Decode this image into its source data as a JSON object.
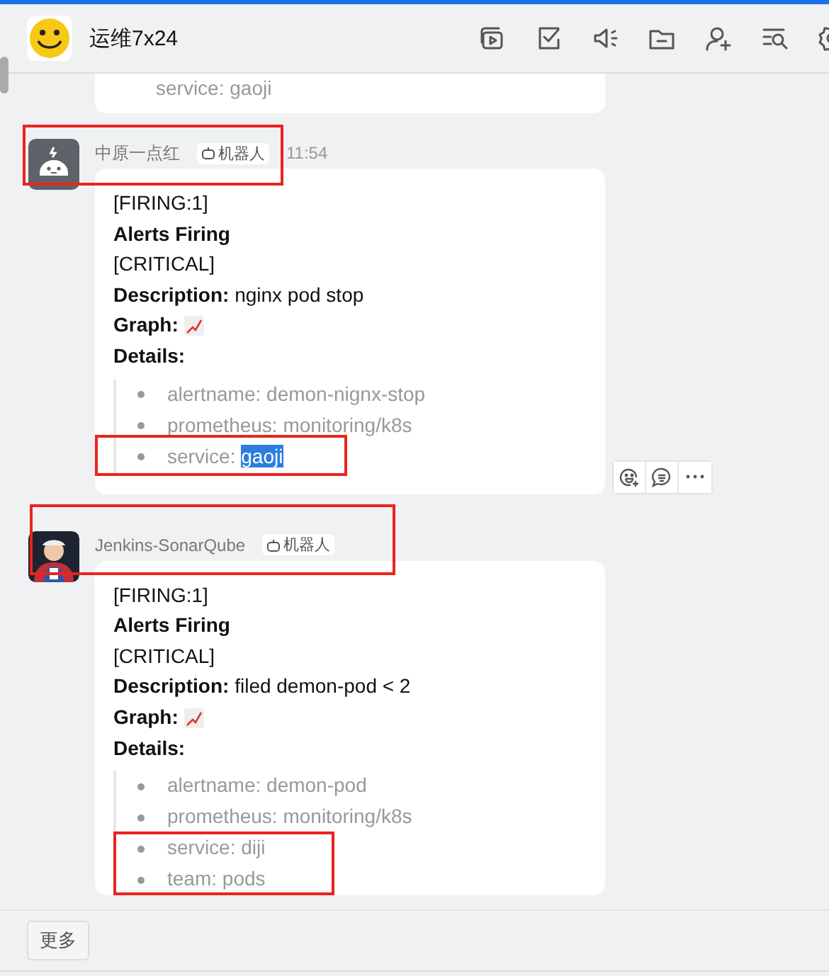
{
  "header": {
    "title": "运维7x24"
  },
  "previous_message": {
    "details": [
      {
        "text": "service: gaoji"
      }
    ]
  },
  "messages": [
    {
      "sender": "中原一点红",
      "badge": "机器人",
      "time": "11:54",
      "actions": true,
      "lines": [
        {
          "kind": "plain",
          "text": "[FIRING:1]"
        },
        {
          "kind": "bold",
          "text": "Alerts Firing"
        },
        {
          "kind": "plain",
          "text": "[CRITICAL]"
        },
        {
          "kind": "rich",
          "text": "**Description:** nginx pod stop"
        },
        {
          "kind": "graph",
          "text": "Graph:"
        },
        {
          "kind": "bold",
          "text": "Details:"
        }
      ],
      "details": [
        {
          "text": "alertname: demon-nignx-stop"
        },
        {
          "text": "prometheus: monitoring/k8s"
        },
        {
          "text": "service: ",
          "highlight": "gaoji"
        }
      ]
    },
    {
      "sender": "Jenkins-SonarQube",
      "badge": "机器人",
      "actions": false,
      "lines": [
        {
          "kind": "plain",
          "text": "[FIRING:1]"
        },
        {
          "kind": "bold",
          "text": "Alerts Firing"
        },
        {
          "kind": "plain",
          "text": "[CRITICAL]"
        },
        {
          "kind": "rich",
          "text": "**Description:** filed demon-pod < 2"
        },
        {
          "kind": "graph",
          "text": "Graph:"
        },
        {
          "kind": "bold",
          "text": "Details:"
        }
      ],
      "details": [
        {
          "text": "alertname: demon-pod"
        },
        {
          "text": "prometheus: monitoring/k8s"
        },
        {
          "text": "service: diji"
        },
        {
          "text": "team: pods"
        }
      ]
    }
  ],
  "footer": {
    "more_button": "更多"
  }
}
